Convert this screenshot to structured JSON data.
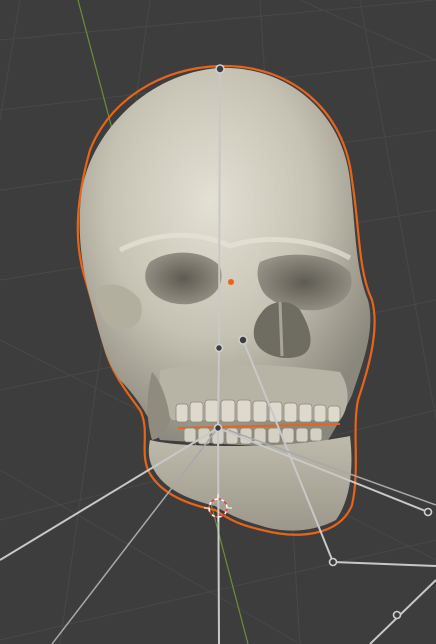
{
  "viewport": {
    "background_color": "#3d3d3d",
    "grid_color": "#4a4a4a",
    "axis_y_color": "#6b8e3a",
    "selection_outline_color": "#e8641b",
    "object_origin_color": "#e8641b",
    "bone_color": "#c8c8c8",
    "skull_base_color": "#c6c2b3",
    "object": {
      "name_icon": "skull-mesh",
      "selected": true
    },
    "armature": {
      "icon": "armature-bones",
      "bone_count": 8
    },
    "cursor_icon": "3d-cursor-icon"
  }
}
